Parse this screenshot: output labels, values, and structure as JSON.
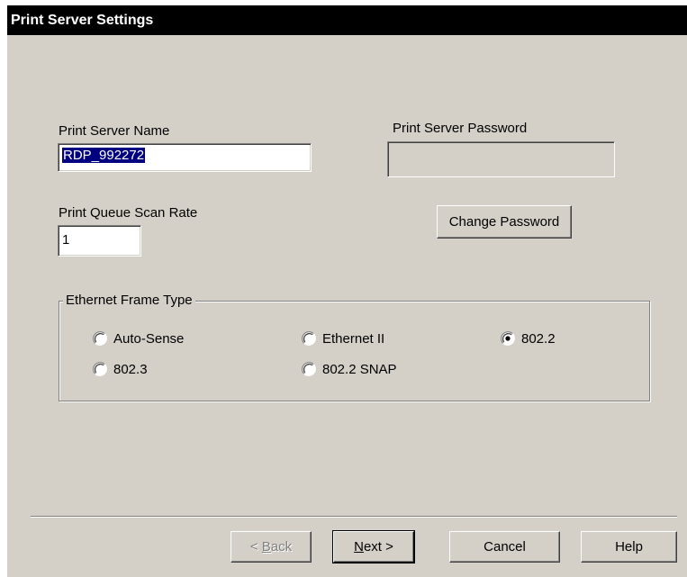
{
  "window": {
    "title": "Print Server Settings"
  },
  "server_name": {
    "label": "Print Server Name",
    "value": "RDP_992272"
  },
  "server_password": {
    "label": "Print Server Password",
    "value": ""
  },
  "scan_rate": {
    "label": "Print Queue Scan Rate",
    "value": "1"
  },
  "change_password": {
    "label": "Change  Password"
  },
  "frame_type": {
    "title": "Ethernet Frame Type",
    "options": [
      {
        "label": "Auto-Sense",
        "checked": false
      },
      {
        "label": "Ethernet II",
        "checked": false
      },
      {
        "label": "802.2",
        "checked": true
      },
      {
        "label": "802.3",
        "checked": false
      },
      {
        "label": "802.2 SNAP",
        "checked": false
      }
    ]
  },
  "buttons": {
    "back": {
      "accel": "B",
      "rest": "ack",
      "prefix": "< "
    },
    "next": {
      "accel": "N",
      "rest": "ext >"
    },
    "cancel": "Cancel",
    "help": "Help"
  }
}
